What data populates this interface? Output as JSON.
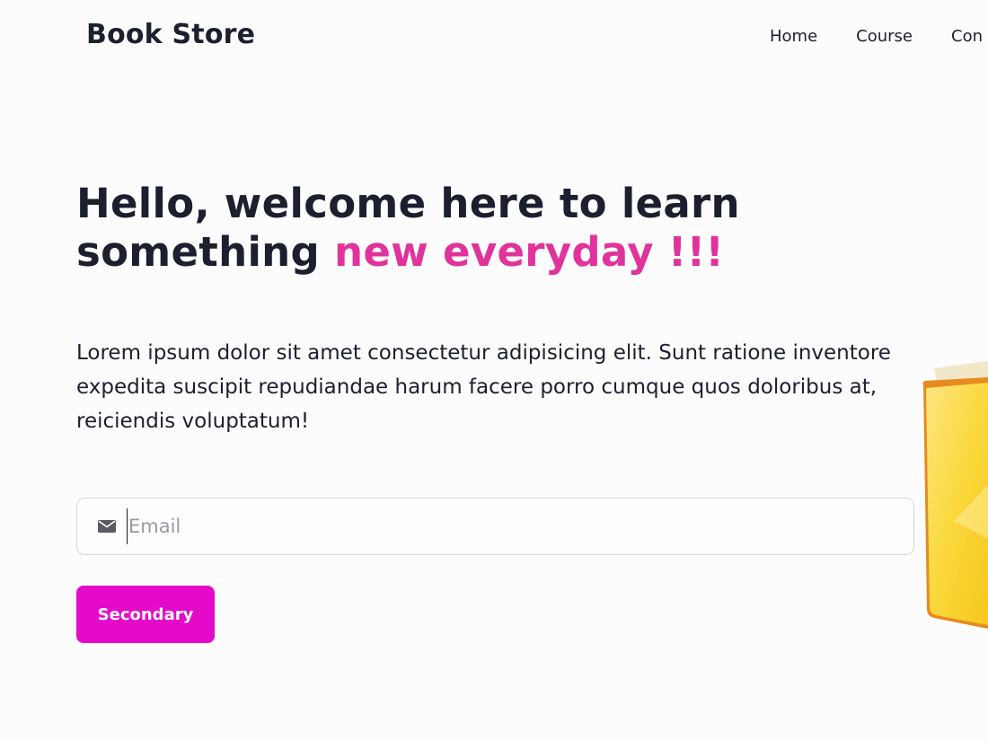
{
  "navbar": {
    "brand": "Book Store",
    "links": [
      {
        "label": "Home"
      },
      {
        "label": "Course"
      },
      {
        "label": "Con"
      }
    ]
  },
  "hero": {
    "title_main": "Hello, welcome here to learn something ",
    "title_accent": "new everyday !!!",
    "description": "Lorem ipsum dolor sit amet consectetur adipisicing elit. Sunt ratione inventore expedita suscipit repudiandae harum facere porro cumque quos doloribus at, reiciendis voluptatum!"
  },
  "email": {
    "placeholder": "Email",
    "value": "",
    "icon": "envelope-icon"
  },
  "button": {
    "label": "Secondary"
  },
  "colors": {
    "accent": "#e0339c",
    "button_bg": "#e50ac9",
    "text_dark": "#1c1f2e",
    "book_yellow": "#f9cd2a"
  }
}
